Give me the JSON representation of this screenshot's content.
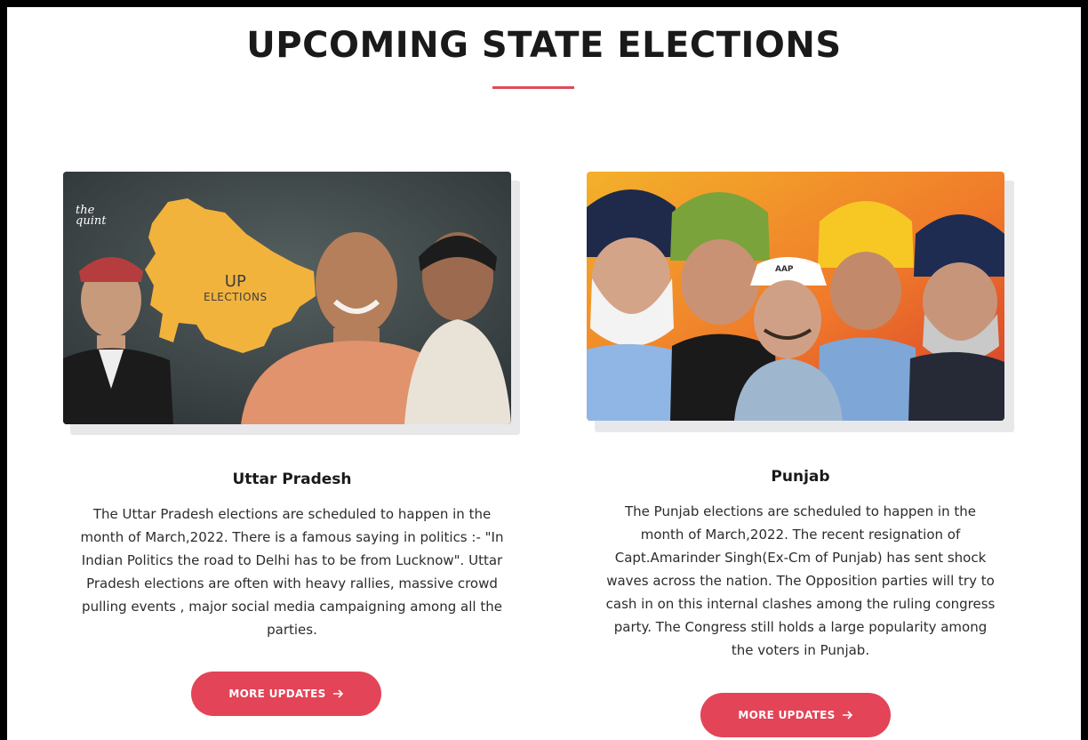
{
  "page": {
    "title": "UPCOMING STATE ELECTIONS",
    "accent_color": "#e04a59",
    "button_color": "#e34457"
  },
  "cards": [
    {
      "title": "Uttar Pradesh",
      "image": {
        "watermark": "the quint",
        "map_line1": "UP",
        "map_line2": "ELECTIONS"
      },
      "text": [
        "The Uttar Pradesh elections are scheduled to happen in the",
        "month of March,2022. There is a famous saying in politics :- \"In",
        "Indian Politics the road to Delhi has to be from Lucknow\". Uttar",
        "Pradesh elections are often with heavy rallies, massive crowd",
        "pulling events , major social media campaigning among all the",
        "parties."
      ],
      "button_label": "MORE UPDATES"
    },
    {
      "title": "Punjab",
      "image": {
        "cap_text": "AAP"
      },
      "text": [
        "The Punjab elections are scheduled to happen in the",
        "month of March,2022. The recent resignation of",
        "Capt.Amarinder Singh(Ex-Cm of Punjab) has sent shock",
        "waves across the nation. The Opposition parties will try to",
        "cash in on this internal clashes among the ruling congress",
        "party. The Congress still holds a large popularity among",
        "the voters in Punjab."
      ],
      "button_label": "MORE UPDATES"
    }
  ]
}
